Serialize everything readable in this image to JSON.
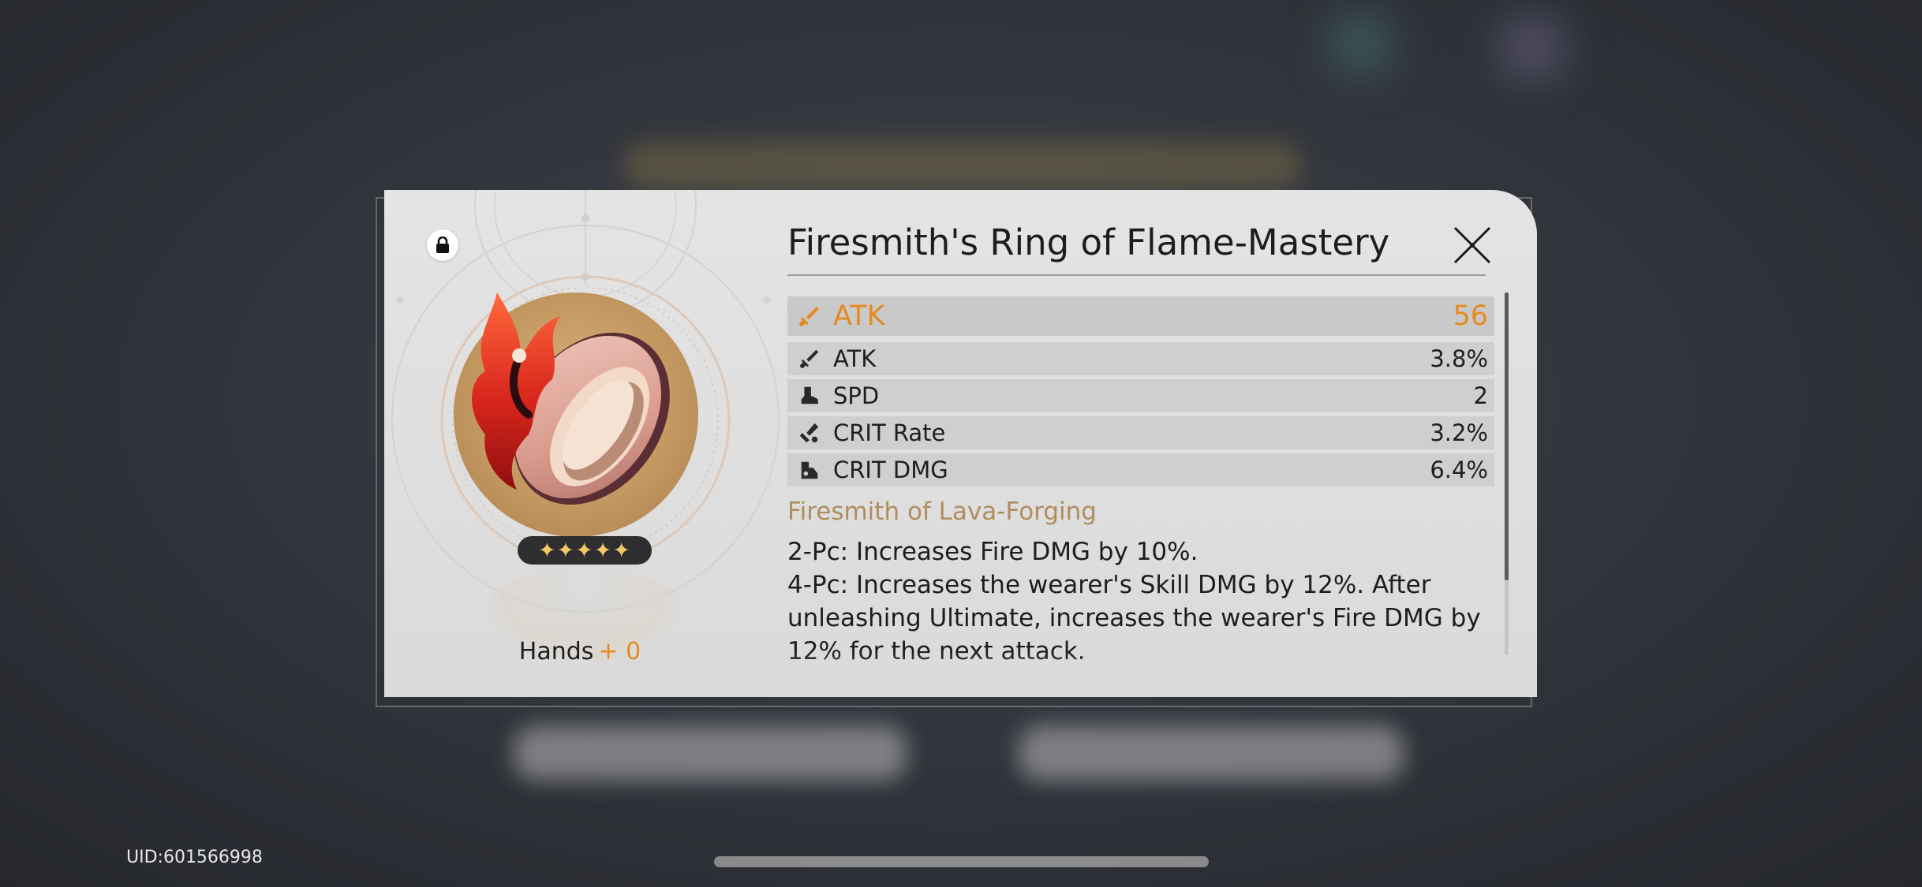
{
  "window": {
    "uid": "UID:601566998"
  },
  "relic": {
    "title": "Firesmith's Ring of Flame-Mastery",
    "stars": "✦✦✦✦✦",
    "rarity": 5,
    "slot": "Hands",
    "level": "+ 0",
    "locked": true,
    "main_stat": {
      "name": "ATK",
      "value": "56",
      "icon": "sword-icon"
    },
    "sub_stats": [
      {
        "name": "ATK",
        "value": "3.8%",
        "icon": "sword-icon"
      },
      {
        "name": "SPD",
        "value": "2",
        "icon": "boot-icon"
      },
      {
        "name": "CRIT Rate",
        "value": "3.2%",
        "icon": "crit-rate-icon"
      },
      {
        "name": "CRIT DMG",
        "value": "6.4%",
        "icon": "crit-dmg-icon"
      }
    ],
    "set": {
      "name": "Firesmith of Lava-Forging",
      "effect_2pc": "2-Pc: Increases Fire DMG by 10%.",
      "effect_4pc": "4-Pc: Increases the wearer's Skill DMG by 12%. After unleashing Ultimate, increases the wearer's Fire DMG by 12% for the next attack."
    }
  },
  "colors": {
    "accent_orange": "#e58a1f",
    "set_name_gold": "#b08d5d",
    "dialog_bg": "#e0e0e0"
  }
}
